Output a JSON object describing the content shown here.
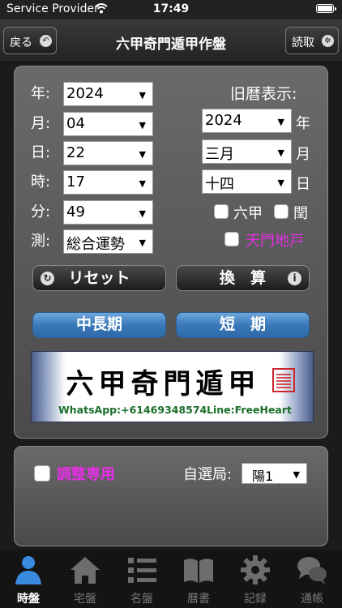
{
  "status": {
    "carrier": "Service Provider",
    "time": "17:49"
  },
  "nav": {
    "title": "六甲奇門遁甲作盤",
    "back_label": "戻る",
    "read_label": "読取"
  },
  "form": {
    "year_label": "年:",
    "month_label": "月:",
    "day_label": "日:",
    "hour_label": "時:",
    "minute_label": "分:",
    "measure_label": "測:",
    "year": "2024",
    "month": "04",
    "day": "22",
    "hour": "17",
    "minute": "49",
    "measure": "総合運勢",
    "lunar_title": "旧暦表示:",
    "lunar_year": "2024",
    "lunar_month": "三月",
    "lunar_day": "十四",
    "lunar_year_unit": "年",
    "lunar_month_unit": "月",
    "lunar_day_unit": "日",
    "liujia_label": "六甲",
    "leap_label": "閏",
    "tianmen_label": "天門地戸"
  },
  "buttons": {
    "reset": "リセット",
    "convert": "換　算",
    "long_term": "中長期",
    "short_term": "短　期"
  },
  "banner": {
    "title": "六甲奇門遁甲",
    "whatsapp": "WhatsApp:+61469348574",
    "line": "Line:FreeHeart"
  },
  "adjust": {
    "label": "調整専用",
    "select_label": "自選局:",
    "select_value": "陽1"
  },
  "tabs": [
    {
      "label": "時盤",
      "icon": "user-icon"
    },
    {
      "label": "宅盤",
      "icon": "home-icon"
    },
    {
      "label": "名盤",
      "icon": "list-icon"
    },
    {
      "label": "曆書",
      "icon": "book-icon"
    },
    {
      "label": "記録",
      "icon": "gear-icon"
    },
    {
      "label": "通帳",
      "icon": "chat-icon"
    }
  ],
  "colors": {
    "accent_magenta": "#e52fe5",
    "tab_active": "#3a8ae0",
    "button_blue": "#3a78b8"
  }
}
